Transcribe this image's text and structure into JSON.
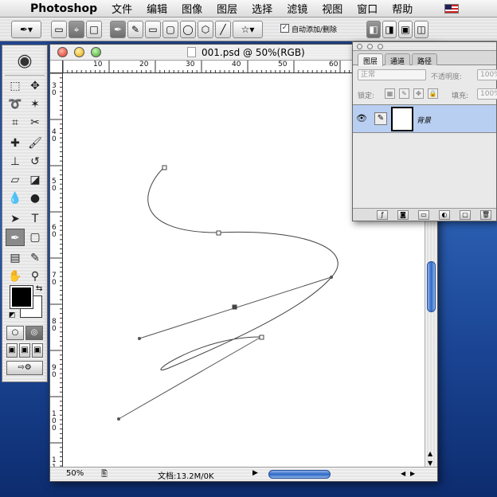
{
  "menubar": {
    "app": "Photoshop",
    "items": [
      "文件",
      "编辑",
      "图像",
      "图层",
      "选择",
      "滤镜",
      "视图",
      "窗口",
      "帮助"
    ]
  },
  "options": {
    "auto_add_delete_label": "自动添加/删除",
    "auto_add_delete_checked": true
  },
  "toolbox": {
    "tools_left": [
      "marquee-tool",
      "lasso-tool",
      "crop-tool",
      "healing-tool",
      "stamp-tool",
      "eraser-tool",
      "blur-tool",
      "path-select-tool",
      "pen-tool",
      "notes-tool",
      "hand-tool"
    ],
    "tools_right": [
      "move-tool",
      "magic-wand-tool",
      "slice-tool",
      "brush-tool",
      "history-brush-tool",
      "gradient-tool",
      "dodge-tool",
      "type-tool",
      "shape-tool",
      "eyedropper-tool",
      "zoom-tool"
    ],
    "selected_tool": "pen-tool",
    "foreground_color": "#000000",
    "background_color": "#ffffff"
  },
  "document": {
    "title": "001.psd @ 50%(RGB)",
    "zoom": "50%",
    "doc_info": "文档:13.2M/0K",
    "ruler_top_labels": [
      "10",
      "20",
      "30",
      "40",
      "50",
      "60"
    ],
    "ruler_left_labels": [
      "3\n0",
      "4\n0",
      "5\n0",
      "6\n0",
      "7\n0",
      "8\n0",
      "9\n0",
      "1\n0\n0",
      "1\n1"
    ]
  },
  "layers_panel": {
    "tabs": [
      "图层",
      "通道",
      "路径"
    ],
    "active_tab": "图层",
    "blend_mode": "正常",
    "opacity_label": "不透明度:",
    "opacity_value": "100%",
    "lock_label": "锁定:",
    "fill_label": "填充:",
    "fill_value": "100%",
    "layer": {
      "name": "背景",
      "visible": true
    }
  }
}
